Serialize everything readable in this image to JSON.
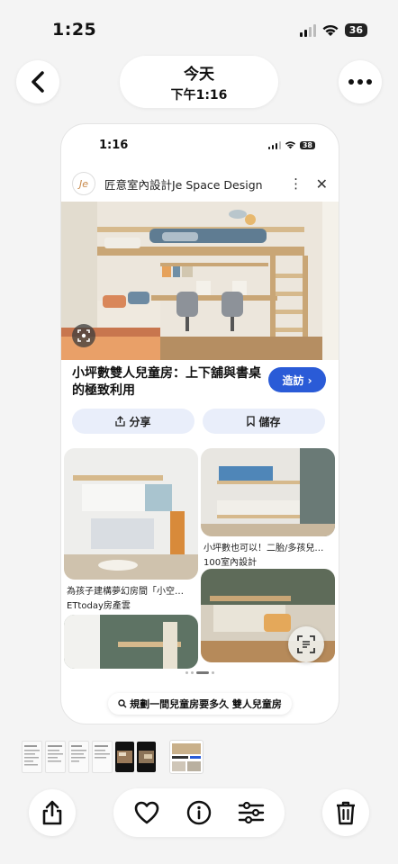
{
  "status_bar": {
    "time": "1:25",
    "battery": "36"
  },
  "header": {
    "title": "今天",
    "subtitle": "下午1:16"
  },
  "screenshot": {
    "status_bar": {
      "time": "1:16",
      "battery": "38"
    },
    "pin": {
      "source_name": "匠意室內設計Je Space Design",
      "logo_text": "Je",
      "title": "小坪數雙人兒童房：上下舖與書桌的極致利用",
      "visit_label": "造訪 ›",
      "share_label": "分享",
      "save_label": "儲存"
    },
    "related": [
      {
        "caption": "為孩子建構夢幻房間「小空…",
        "source": "ETtoday房產雲"
      },
      {
        "caption": "小坪數也可以！二胎/多孩兒…",
        "source": "100室內設計"
      }
    ],
    "search_chip": "規劃一間兒童房要多久  雙人兒童房"
  },
  "bottom_toolbar": {
    "icons": [
      "share-icon",
      "heart-icon",
      "info-icon",
      "adjust-icon",
      "trash-icon"
    ]
  },
  "colors": {
    "accent": "#2a5bd7",
    "background": "#f4f4f4"
  }
}
